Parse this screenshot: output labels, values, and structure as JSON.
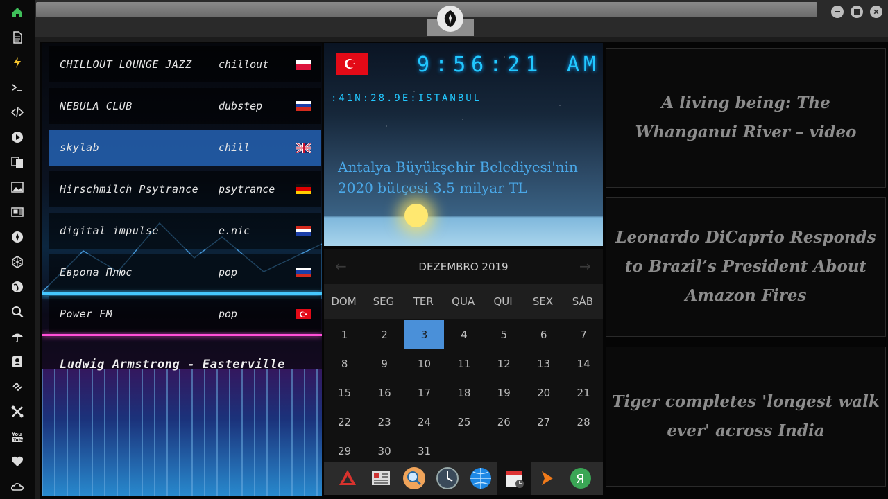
{
  "dock": {
    "items": [
      "home-icon",
      "document-icon",
      "flash-icon",
      "terminal-icon",
      "code-icon",
      "play-icon",
      "translate-icon",
      "image-icon",
      "news-icon",
      "rebel-icon",
      "hexagon-icon",
      "globe-icon",
      "search-icon",
      "umbrella-icon",
      "contacts-icon",
      "link-icon",
      "tools-icon",
      "youtube-icon",
      "heart-icon",
      "cloud-icon"
    ]
  },
  "radio": {
    "stations": [
      {
        "name": "CHILLOUT LOUNGE JAZZ",
        "genre": "chillout",
        "flag": "pl"
      },
      {
        "name": "NEBULA CLUB",
        "genre": "dubstep",
        "flag": "ru"
      },
      {
        "name": "skylab",
        "genre": "chill",
        "flag": "gb",
        "active": true
      },
      {
        "name": "Hirschmilch Psytrance",
        "genre": "psytrance",
        "flag": "de"
      },
      {
        "name": "digital impulse",
        "genre": "e.nic",
        "flag": "hr"
      },
      {
        "name": "Европа Плюс",
        "genre": "pop",
        "flag": "ru"
      },
      {
        "name": "Power FM",
        "genre": "pop",
        "flag": "tr"
      }
    ],
    "now_playing": "Ludwig Armstrong - Easterville"
  },
  "clock": {
    "time": "9:56:21",
    "ampm": "AM",
    "location": ":41N:28.9E:ISTANBUL",
    "headline": "Antalya Büyükşehir Belediyesi'nin 2020 bütçesi 3.5 milyar TL"
  },
  "calendar": {
    "month": "DEZEMBRO 2019",
    "day_names": [
      "DOM",
      "SEG",
      "TER",
      "QUA",
      "QUI",
      "SEX",
      "SÁB"
    ],
    "first_weekday": 0,
    "days_in_month": 31,
    "today": 3
  },
  "launcher": [
    "anydesk-icon",
    "news-app-icon",
    "search-app-icon",
    "clock-app-icon",
    "browser-icon",
    "calendar-app-icon",
    "forward-icon",
    "yandex-icon"
  ],
  "news": [
    "A living being: The Whanganui River – video",
    "Leonardo DiCaprio Responds to Brazil’s President About Amazon Fires",
    "Tiger completes 'longest walk ever' across India"
  ],
  "colors": {
    "accent": "#4a90d9",
    "clock_cyan": "#22c8ff",
    "active_station": "#286ec8"
  }
}
